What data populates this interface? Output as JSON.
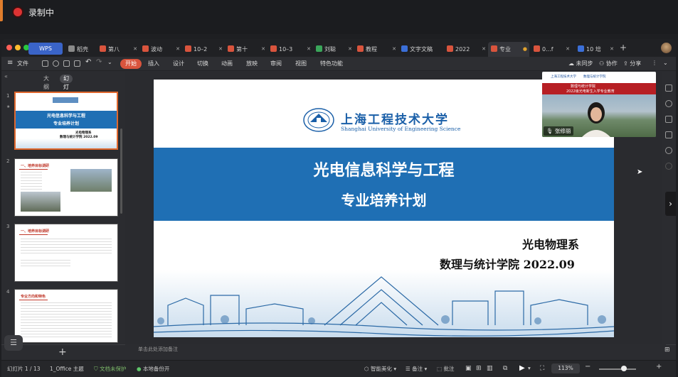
{
  "recording": {
    "label": "录制中"
  },
  "tabs": [
    {
      "label": "WPS",
      "kind": "home"
    },
    {
      "label": "稻壳",
      "icon_color": "#8a8a8a"
    },
    {
      "label": "第八",
      "icon_color": "#d9543d"
    },
    {
      "label": "波动",
      "icon_color": "#d9543d"
    },
    {
      "label": "10–2",
      "icon_color": "#d9543d"
    },
    {
      "label": "第十",
      "icon_color": "#d9543d"
    },
    {
      "label": "10–3",
      "icon_color": "#d9543d"
    },
    {
      "label": "刘聪",
      "icon_color": "#3aa65a"
    },
    {
      "label": "教程",
      "icon_color": "#d9543d"
    },
    {
      "label": "文字文稿",
      "icon_color": "#3b6fd8"
    },
    {
      "label": "2022",
      "icon_color": "#d9543d"
    },
    {
      "label": "专业",
      "icon_color": "#d9543d",
      "active": true
    },
    {
      "label": "0...f",
      "icon_color": "#d9543d"
    },
    {
      "label": "10 培",
      "icon_color": "#3b6fd8"
    }
  ],
  "menu": {
    "file": "文件",
    "items": [
      "开始",
      "插入",
      "设计",
      "切换",
      "动画",
      "放映",
      "审阅",
      "视图",
      "特色功能"
    ],
    "right": [
      "未同步",
      "协作",
      "分享"
    ]
  },
  "sidebar": {
    "view_tabs": [
      "大纲",
      "幻灯片"
    ],
    "thumbs": [
      {
        "num": "1",
        "title1": "光电信息科学与工程",
        "title2": "专业培养计划",
        "sub1": "光电物理系",
        "sub2": "数理与统计学院 2022.09"
      },
      {
        "num": "2",
        "heading": "一、培养目标调研"
      },
      {
        "num": "3",
        "heading": "一、培养目标调研"
      },
      {
        "num": "4",
        "heading": "专业方向和特色"
      }
    ],
    "add": "+"
  },
  "slide": {
    "logo_cn": "上海工程技术大学",
    "logo_en": "Shanghai University of Engineering Science",
    "title_line1": "光电信息科学与工程",
    "title_line2": "专业培养计划",
    "dept": "光电物理系",
    "school": "数理与统计学院 2022.09",
    "brand_color": "#1f6fb4"
  },
  "webcam": {
    "logo1": "上海工程技术大学",
    "logo2": "数理与统计学院",
    "line1": "数理与统计学院",
    "line2": "2022级光电新生入学专业教育",
    "name": "张修丽"
  },
  "notes": {
    "placeholder": "单击此处添加备注"
  },
  "status": {
    "slide_counter": "幻灯片 1 / 13",
    "theme": "1_Office 主题",
    "protect": "文档未保护",
    "backup": "本地备份开",
    "beautify": "智能美化",
    "notes": "备注",
    "comments": "批注",
    "zoom": "113%"
  }
}
